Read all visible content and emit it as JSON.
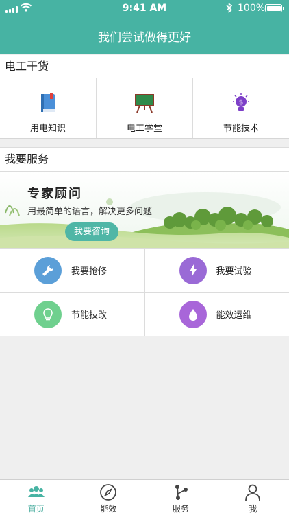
{
  "status_bar": {
    "time": "9:41 AM",
    "battery": "100%"
  },
  "header": {
    "title": "我们尝试做得更好"
  },
  "dry_goods": {
    "title": "电工干货",
    "items": [
      {
        "label": "用电知识",
        "icon": "book-icon"
      },
      {
        "label": "电工学堂",
        "icon": "blackboard-icon"
      },
      {
        "label": "节能技术",
        "icon": "money-bulb-icon"
      }
    ]
  },
  "services": {
    "title": "我要服务",
    "banner": {
      "title": "专家顾问",
      "subtitle": "用最简单的语言，解决更多问题",
      "button": "我要咨询"
    },
    "items": [
      {
        "label": "我要抢修",
        "icon": "wrench-icon",
        "color": "#5b9fd8"
      },
      {
        "label": "我要试验",
        "icon": "lightning-icon",
        "color": "#9a6ad6"
      },
      {
        "label": "节能技改",
        "icon": "lightbulb-icon",
        "color": "#6fd08e"
      },
      {
        "label": "能效运维",
        "icon": "drop-icon",
        "color": "#a866d9"
      }
    ]
  },
  "tabs": [
    {
      "label": "首页",
      "icon": "people-icon",
      "active": true
    },
    {
      "label": "能效",
      "icon": "compass-icon",
      "active": false
    },
    {
      "label": "服务",
      "icon": "branch-icon",
      "active": false
    },
    {
      "label": "我",
      "icon": "user-icon",
      "active": false
    }
  ],
  "colors": {
    "accent": "#47b3a3",
    "tab_active": "#3fa899"
  }
}
